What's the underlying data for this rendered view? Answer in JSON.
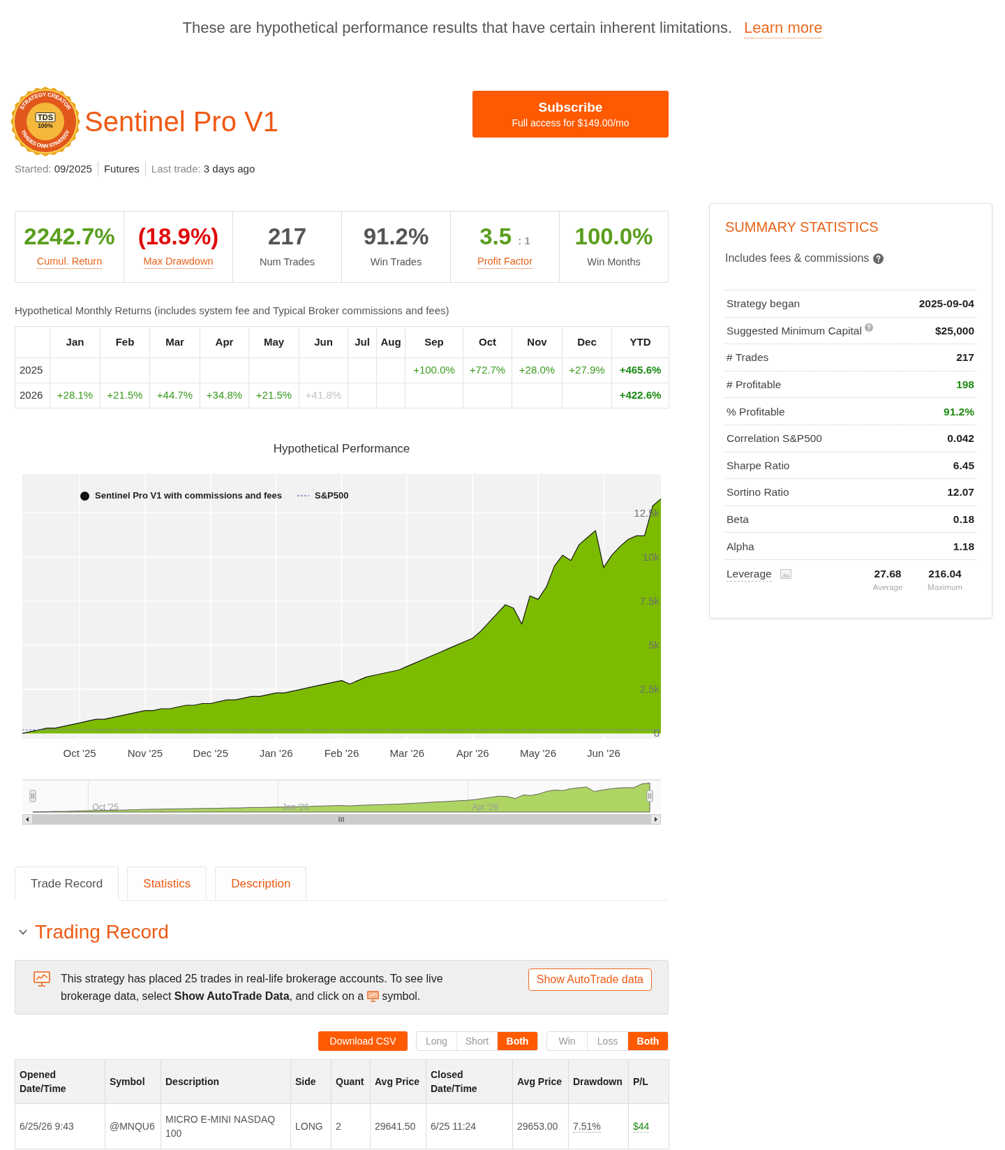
{
  "disclaimer": {
    "text": "These are hypothetical performance results that have certain inherent limitations.",
    "link": "Learn more"
  },
  "strategy": {
    "badge": {
      "top_text": "STRATEGY CREATOR",
      "center_text": "TDS",
      "percent": "100%",
      "bottom_text": "TRADES OWN STRATEGY"
    },
    "title": "Sentinel Pro V1",
    "meta": [
      {
        "label": "Started:",
        "value": "09/2025"
      },
      {
        "value": "Futures"
      },
      {
        "label": "Last trade:",
        "value": "3 days ago"
      }
    ]
  },
  "subscribe": {
    "label": "Subscribe",
    "sublabel": "Full access for $149.00/mo"
  },
  "stats": [
    {
      "value": "2242.7%",
      "label": "Cumul. Return",
      "kind": "gain",
      "link": true
    },
    {
      "value": "(18.9%)",
      "label": "Max Drawdown",
      "kind": "loss",
      "link": true
    },
    {
      "value": "217",
      "label": "Num Trades",
      "kind": "count",
      "link": false
    },
    {
      "value": "91.2%",
      "label": "Win Trades",
      "kind": "count",
      "link": false
    },
    {
      "value": "3.5",
      "suffix": ": 1",
      "label": "Profit Factor",
      "kind": "gain",
      "link": true
    },
    {
      "value": "100.0%",
      "label": "Win Months",
      "kind": "gain",
      "link": false
    }
  ],
  "monthly_returns": {
    "caption": "Hypothetical Monthly Returns (includes system fee and Typical Broker commissions and fees)",
    "columns": [
      "Jan",
      "Feb",
      "Mar",
      "Apr",
      "May",
      "Jun",
      "Jul",
      "Aug",
      "Sep",
      "Oct",
      "Nov",
      "Dec",
      "YTD"
    ],
    "rows": [
      {
        "year": "2025",
        "months": [
          {
            "kind": "blank"
          },
          {
            "kind": "blank"
          },
          {
            "kind": "blank"
          },
          {
            "kind": "blank"
          },
          {
            "kind": "blank"
          },
          {
            "kind": "blank"
          },
          {
            "kind": "blank"
          },
          {
            "kind": "blank"
          },
          {
            "kind": "value",
            "text": "+100.0%",
            "partial": false
          },
          {
            "kind": "value",
            "text": "+72.7%",
            "partial": false
          },
          {
            "kind": "value",
            "text": "+28.0%",
            "partial": false
          },
          {
            "kind": "value",
            "text": "+27.9%",
            "partial": false
          }
        ],
        "ytd": "+465.6%"
      },
      {
        "year": "2026",
        "months": [
          {
            "kind": "value",
            "text": "+28.1%",
            "partial": false
          },
          {
            "kind": "value",
            "text": "+21.5%",
            "partial": false
          },
          {
            "kind": "value",
            "text": "+44.7%",
            "partial": false
          },
          {
            "kind": "value",
            "text": "+34.8%",
            "partial": false
          },
          {
            "kind": "value",
            "text": "+21.5%",
            "partial": false
          },
          {
            "kind": "value",
            "text": "+41.8%",
            "partial": true
          },
          {
            "kind": "blank"
          },
          {
            "kind": "blank"
          },
          {
            "kind": "blank"
          },
          {
            "kind": "blank"
          },
          {
            "kind": "blank"
          },
          {
            "kind": "blank"
          }
        ],
        "ytd": "+422.6%"
      }
    ]
  },
  "performance_chart": {
    "chart_data": {
      "type": "area",
      "title": "Hypothetical Performance",
      "grid": true,
      "categories": [
        null,
        null,
        null,
        null,
        null,
        null,
        null,
        "Oct '25",
        null,
        null,
        null,
        null,
        null,
        null,
        null,
        "Nov '25",
        null,
        null,
        null,
        null,
        null,
        null,
        null,
        "Dec '25",
        null,
        null,
        null,
        null,
        null,
        null,
        null,
        "Jan '26",
        null,
        null,
        null,
        null,
        null,
        null,
        null,
        "Feb '26",
        null,
        null,
        null,
        null,
        null,
        null,
        null,
        "Mar '26",
        null,
        null,
        null,
        null,
        null,
        null,
        null,
        "Apr '26",
        null,
        null,
        null,
        null,
        null,
        null,
        null,
        "May '26",
        null,
        null,
        null,
        null,
        null,
        null,
        null,
        "Jun '26",
        null,
        null,
        null,
        null,
        null,
        null,
        null
      ],
      "series": [
        {
          "name": "Sentinel Pro V1 with commissions and fees",
          "color": "#7cbb00",
          "values": [
            0,
            100,
            200,
            300,
            300,
            400,
            500,
            600,
            700,
            800,
            800,
            900,
            1000,
            1100,
            1200,
            1300,
            1300,
            1400,
            1400,
            1500,
            1600,
            1600,
            1700,
            1700,
            1800,
            1900,
            1900,
            2000,
            2100,
            2100,
            2200,
            2300,
            2300,
            2400,
            2500,
            2600,
            2700,
            2800,
            2900,
            3000,
            2800,
            3000,
            3200,
            3300,
            3400,
            3500,
            3600,
            3800,
            4000,
            4200,
            4400,
            4600,
            4800,
            5000,
            5200,
            5400,
            5800,
            6300,
            6800,
            7300,
            7100,
            6200,
            7800,
            7600,
            8300,
            9500,
            10100,
            9800,
            10700,
            11100,
            11500,
            9400,
            10100,
            10600,
            11000,
            11200,
            11200,
            12900,
            13300
          ]
        },
        {
          "name": "S&P500",
          "type": "line",
          "line_style": "dashed",
          "color": "#8080c8",
          "values": [
            200,
            200,
            200,
            200,
            200,
            200,
            200,
            200,
            200,
            200,
            200,
            200,
            200,
            200,
            200,
            200,
            200,
            200,
            200,
            200,
            200,
            200,
            200,
            200,
            200,
            200,
            200,
            200,
            200,
            200,
            200,
            200,
            200,
            200,
            200,
            200,
            200,
            200,
            200,
            200,
            200,
            200,
            200,
            200,
            200,
            200,
            200,
            200,
            200,
            200,
            200,
            200,
            200,
            200,
            200,
            200,
            200,
            200,
            200,
            200,
            200,
            200,
            200,
            200,
            200,
            200,
            200,
            200,
            200,
            200,
            200,
            200,
            200,
            200,
            200,
            200,
            200,
            200,
            200
          ]
        }
      ],
      "ylim": [
        -300,
        14700
      ],
      "yticks": [
        {
          "value": 0,
          "label": "0"
        },
        {
          "value": 2500,
          "label": "2.5k"
        },
        {
          "value": 5000,
          "label": "5k"
        },
        {
          "value": 7500,
          "label": "7.5k"
        },
        {
          "value": 10000,
          "label": "10k"
        },
        {
          "value": 12500,
          "label": "12.5k"
        }
      ]
    },
    "navigator": {
      "labels": [
        "Oct '25",
        "Jan '26",
        "Apr '26"
      ]
    }
  },
  "tabs": [
    {
      "label": "Trade Record",
      "selected": true
    },
    {
      "label": "Statistics",
      "selected": false
    },
    {
      "label": "Description",
      "selected": false
    }
  ],
  "trading_record": {
    "title": "Trading Record",
    "expanded": true,
    "notice": {
      "text_before_icon": "This strategy has placed 25 trades in real-life brokerage accounts. To see live brokerage data, select **Show AutoTrade Data**, and click on a ",
      "text_after_icon": " symbol.",
      "button": "Show AutoTrade data"
    },
    "download_button": "Download CSV",
    "filters": [
      [
        {
          "label": "Long",
          "selected": false
        },
        {
          "label": "Short",
          "selected": false
        },
        {
          "label": "Both",
          "selected": true
        }
      ],
      [
        {
          "label": "Win",
          "selected": false
        },
        {
          "label": "Loss",
          "selected": false
        },
        {
          "label": "Both",
          "selected": true
        }
      ]
    ],
    "table": {
      "columns": [
        {
          "label": "Opened Date/Time",
          "kind": "plain"
        },
        {
          "label": "Symbol",
          "kind": "plain"
        },
        {
          "label": "Description",
          "kind": "plain"
        },
        {
          "label": "Side",
          "kind": "plain"
        },
        {
          "label": "Quant",
          "kind": "plain"
        },
        {
          "label": "Avg Price",
          "kind": "plain"
        },
        {
          "label": "Closed Date/Time",
          "kind": "plain"
        },
        {
          "label": "Avg Price",
          "kind": "plain"
        },
        {
          "label": "Drawdown",
          "kind": "hint"
        },
        {
          "label": "P/L",
          "kind": "pl"
        }
      ],
      "rows": [
        {
          "cells": [
            "6/25/26 9:43",
            "@MNQU6",
            "MICRO E-MINI NASDAQ 100",
            "LONG",
            "2",
            "29641.50",
            "6/25 11:24",
            "29653.00",
            "7.51%",
            "$44"
          ],
          "kind": "win"
        }
      ]
    }
  },
  "summary_statistics": {
    "title": "SUMMARY STATISTICS",
    "subtitle": {
      "text": "Includes fees & commissions",
      "help": true
    },
    "rows": [
      {
        "kind": "single",
        "label": "Strategy began",
        "value": "2025-09-04",
        "positive": false,
        "help": false
      },
      {
        "kind": "single",
        "label": "Suggested Minimum Capital",
        "value": "$25,000",
        "positive": false,
        "help": true
      },
      {
        "kind": "single",
        "label": "# Trades",
        "value": "217",
        "positive": false,
        "help": false
      },
      {
        "kind": "single",
        "label": "# Profitable",
        "value": "198",
        "positive": true,
        "help": false
      },
      {
        "kind": "single",
        "label": "% Profitable",
        "value": "91.2%",
        "positive": true,
        "help": false
      },
      {
        "kind": "single",
        "label": "Correlation S&P500",
        "value": "0.042",
        "positive": false,
        "help": false
      },
      {
        "kind": "single",
        "label": "Sharpe Ratio",
        "value": "6.45",
        "positive": false,
        "help": false
      },
      {
        "kind": "single",
        "label": "Sortino Ratio",
        "value": "12.07",
        "positive": false,
        "help": false
      },
      {
        "kind": "single",
        "label": "Beta",
        "value": "0.18",
        "positive": false,
        "help": false
      },
      {
        "kind": "single",
        "label": "Alpha",
        "value": "1.18",
        "positive": false,
        "help": false
      },
      {
        "kind": "pair",
        "label": "Leverage",
        "help": false,
        "values": [
          {
            "value": "27.68",
            "caption": "Average"
          },
          {
            "value": "216.04",
            "caption": "Maximum"
          }
        ]
      }
    ]
  }
}
